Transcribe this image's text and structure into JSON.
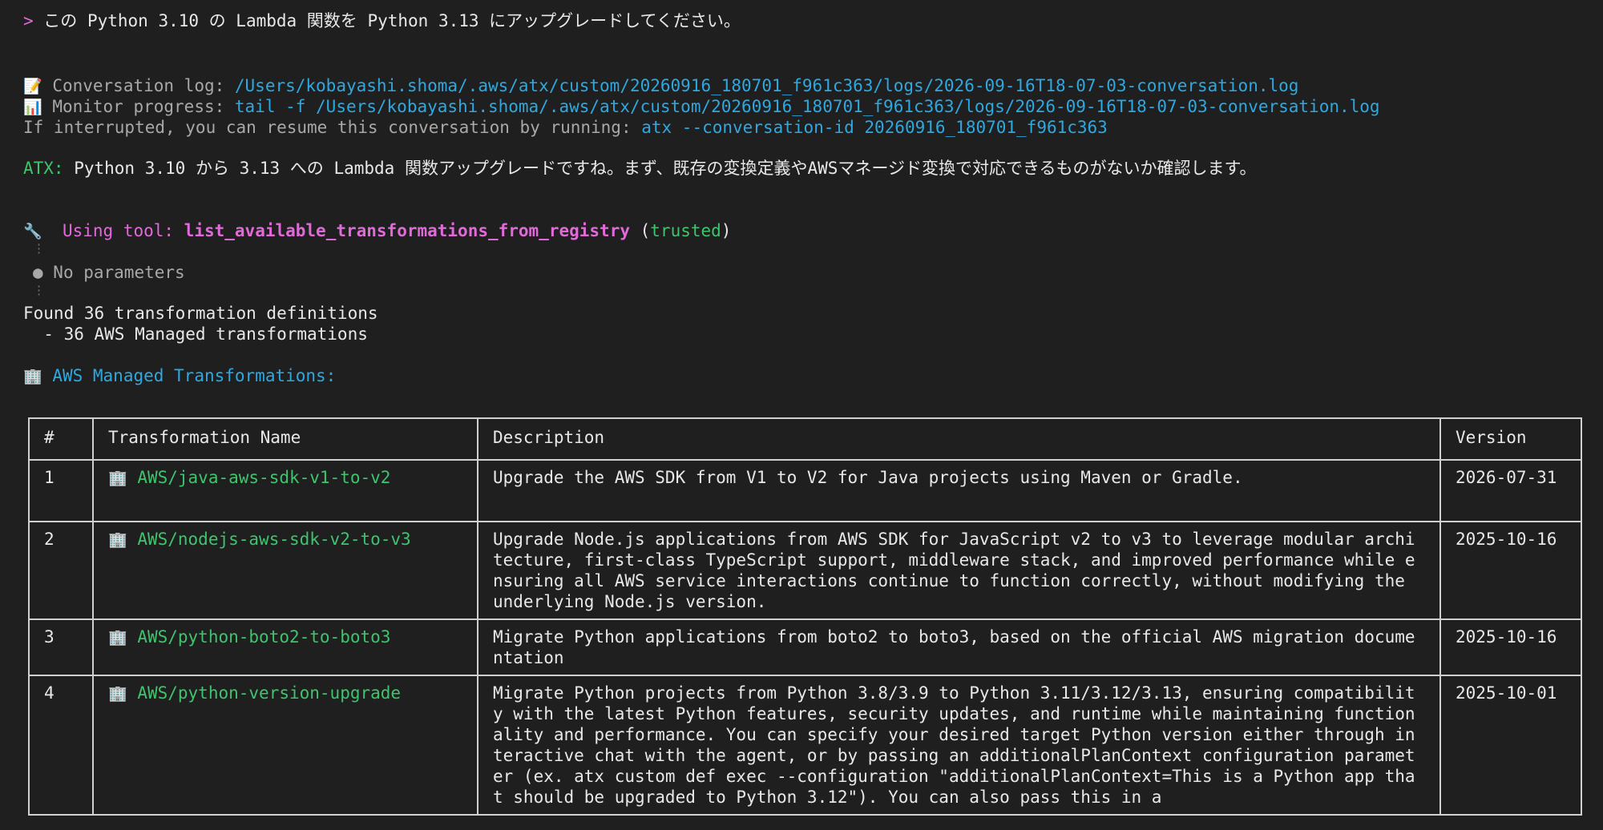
{
  "prompt": {
    "marker": ">",
    "text": " この Python 3.10 の Lambda 関数を Python 3.13 にアップグレードしてください。"
  },
  "log": {
    "conversation_label": " Conversation log: ",
    "conversation_path": "/Users/kobayashi.shoma/.aws/atx/custom/20260916_180701_f961c363/logs/2026-09-16T18-07-03-conversation.log",
    "monitor_label": " Monitor progress: ",
    "monitor_cmd": "tail -f /Users/kobayashi.shoma/.aws/atx/custom/20260916_180701_f961c363/logs/2026-09-16T18-07-03-conversation.log",
    "resume_text": "If interrupted, you can resume this conversation by running: ",
    "resume_cmd": "atx --conversation-id 20260916_180701_f961c363"
  },
  "atx": {
    "label": "ATX:",
    "message": " Python 3.10 から 3.13 への Lambda 関数アップグレードですね。まず、既存の変換定義やAWSマネージド変換で対応できるものがないか確認します。"
  },
  "tool": {
    "icon": "wrench-icon",
    "using_label": "Using tool: ",
    "name": "list_available_transformations_from_registry",
    "open_paren": " (",
    "trust": "trusted",
    "close_paren": ")",
    "dots": "⋮",
    "param_bullet": "●",
    "params": " No parameters"
  },
  "found": {
    "line1": "Found 36 transformation definitions",
    "line2": "  - 36 AWS Managed transformations"
  },
  "section": {
    "icon": "building-icon",
    "title": " AWS Managed Transformations:"
  },
  "table": {
    "headers": [
      "#",
      "Transformation Name",
      "Description",
      "Version"
    ],
    "rows": [
      {
        "num": "1",
        "name": "AWS/java-aws-sdk-v1-to-v2",
        "description": "Upgrade the AWS SDK from V1 to V2 for Java projects using Maven or Gradle.",
        "version": "2026-07-31"
      },
      {
        "num": "2",
        "name": "AWS/nodejs-aws-sdk-v2-to-v3",
        "description": "Upgrade Node.js applications from AWS SDK for JavaScript v2 to v3 to leverage modular architecture, first-class TypeScript support, middleware stack, and improved performance while ensuring all AWS service interactions continue to function correctly, without modifying the underlying Node.js version.",
        "version": "2025-10-16"
      },
      {
        "num": "3",
        "name": "AWS/python-boto2-to-boto3",
        "description": "Migrate Python applications from boto2 to boto3, based on the official AWS migration documentation",
        "version": "2025-10-16"
      },
      {
        "num": "4",
        "name": "AWS/python-version-upgrade",
        "description": "Migrate Python projects from Python 3.8/3.9 to Python 3.11/3.12/3.13, ensuring compatibility with the latest Python features, security updates, and runtime while maintaining functionality and performance. You can specify your desired target Python version either through interactive chat with the agent, or by passing an additionalPlanContext configuration parameter (ex. atx custom def exec --configuration \"additionalPlanContext=This is a Python app that should be upgraded to Python 3.12\"). You can also pass this in a",
        "version": "2025-10-01"
      }
    ]
  },
  "colors": {
    "background": "#1f1f1f",
    "prompt": "#e06ad8",
    "link": "#2ea8e0",
    "success": "#3ec46d",
    "muted": "#a8a8a8"
  }
}
